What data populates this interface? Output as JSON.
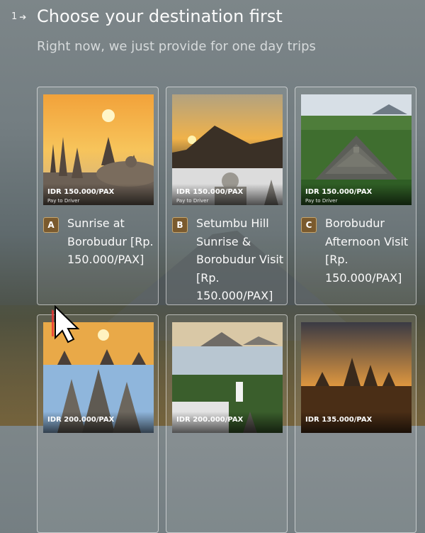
{
  "question": {
    "number": "1",
    "title": "Choose your destination first",
    "subtitle": "Right now, we just provide for one day trips"
  },
  "options": [
    {
      "key": "A",
      "label": "Sunrise at Borobudur [Rp. 150.000/PAX]",
      "price": "IDR 150.000/PAX",
      "note": "Pay to Driver"
    },
    {
      "key": "B",
      "label": "Setumbu Hill Sunrise & Borobudur Visit [Rp. 150.000/PAX]",
      "price": "IDR 150.000/PAX",
      "note": "Pay to Driver"
    },
    {
      "key": "C",
      "label": "Borobudur Afternoon Visit [Rp. 150.000/PAX]",
      "price": "IDR 150.000/PAX",
      "note": "Pay to Driver"
    },
    {
      "price": "IDR 200.000/PAX"
    },
    {
      "price": "IDR 200.000/PAX"
    },
    {
      "price": "IDR 135.000/PAX"
    }
  ],
  "colors": {
    "key_badge": "#7a5a2e",
    "key_border": "#c7a56b",
    "card_border": "#ffffff"
  },
  "icons": {
    "arrow": "arrow-right-icon",
    "cursor": "mouse-pointer-icon"
  }
}
